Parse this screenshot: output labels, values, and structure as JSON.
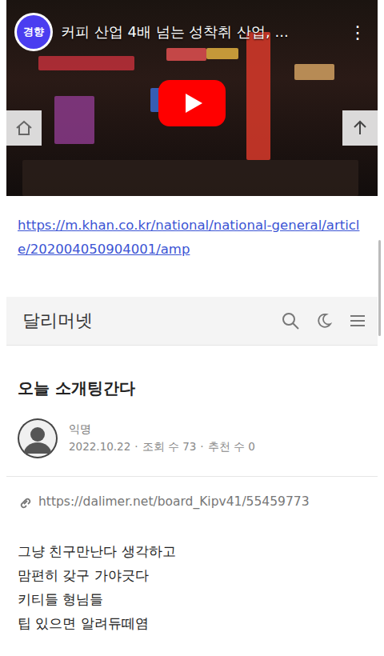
{
  "video": {
    "channel": "경향",
    "title": "커피 산업 4배 넘는 성착취 산업, ...",
    "menu": "⋮"
  },
  "link": "https://m.khan.co.kr/national/national-general/article/202004050904001/amp",
  "site": {
    "name": "달리머넷"
  },
  "post": {
    "title": "오늘 소개팅간다",
    "author": "익명",
    "meta": [
      "2022.10.22",
      "·",
      "조회 수 73",
      "·",
      "추천 수 0"
    ],
    "url": "https://dalimer.net/board_Kipv41/55459773",
    "body": [
      "그냥 친구만난다 생각하고",
      "맘편히 갖구 가야긋다",
      "키티들 형님들",
      "팁 있으면 알려듀떼염"
    ]
  }
}
